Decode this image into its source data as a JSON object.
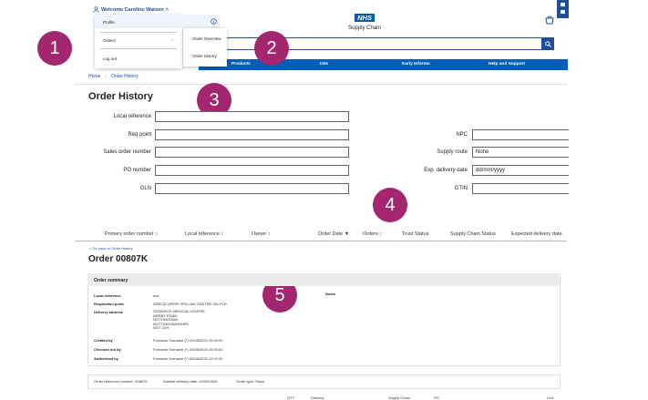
{
  "header": {
    "welcome": "Welcome Caroline Watson",
    "logo_nhs": "NHS",
    "logo_sub": "Supply Chain"
  },
  "dropdown": {
    "items": [
      "Profile",
      "Orders",
      "Log out"
    ],
    "submenu": [
      "Order Overview",
      "Order History"
    ]
  },
  "nav": [
    "Products",
    "IOIs",
    "Early Informs",
    "Help and Support"
  ],
  "breadcrumb": [
    "Home",
    "Order History"
  ],
  "page_title": "Order History",
  "form": {
    "left": [
      {
        "label": "Local reference",
        "value": ""
      },
      {
        "label": "Req point",
        "value": ""
      },
      {
        "label": "Sales order number",
        "value": ""
      },
      {
        "label": "PO number",
        "value": ""
      },
      {
        "label": "GLN",
        "value": ""
      }
    ],
    "right": [
      {
        "label": "NPC",
        "value": ""
      },
      {
        "label": "Supply route",
        "value": "None"
      },
      {
        "label": "Exp. delivery date",
        "value": "dd/mm/yyyy"
      },
      {
        "label": "GTIN",
        "value": ""
      }
    ]
  },
  "table_headers": [
    "Primary order number ↕",
    "Local reference ↕",
    "Owner ↕",
    "Order Date ▼",
    "Orders ↕",
    "Trust Status",
    "Supply Chain Status",
    "Expected delivery date"
  ],
  "badges": [
    "1",
    "2",
    "3",
    "4",
    "5"
  ],
  "order": {
    "back": "< Go back to Order History",
    "title": "Order 00807K",
    "summary_title": "Order summary",
    "notes_label": "Notes",
    "fields": [
      {
        "k": "Local reference",
        "v": "test"
      },
      {
        "k": "Requisition point",
        "v": "26EEQ2 (RRSP SPILLAM CENTRE SID PLR"
      },
      {
        "k": "Delivery address",
        "v": "OODEROS MEDICAL CENTRE\nDERBY ROAD\nNOTTINGHAM\nNOTTINGHAMSHIRE\nNG7 2UH"
      },
      {
        "k": "Created by",
        "v": "Forname Surname (*) 20/08/2020 20:00:00"
      },
      {
        "k": "Checked out by",
        "v": "Forname Surname (*) 20/08/2020 20:00:00"
      },
      {
        "k": "Authorised by",
        "v": "Forname Surname (*) 20/08/2020 12:01:00"
      }
    ],
    "footer": {
      "ref": "Order reference number: 00807K",
      "earliest": "Earliest delivery date: 02/09/2020",
      "type": "Order type: Stock"
    },
    "bottom_headers": [
      "QTY",
      "Delivery",
      "Supply Chain",
      "PO",
      "Line"
    ]
  },
  "colors": {
    "brand": "#005eb8",
    "dark_blue": "#1f4e9c",
    "badge": "#a3266e"
  }
}
